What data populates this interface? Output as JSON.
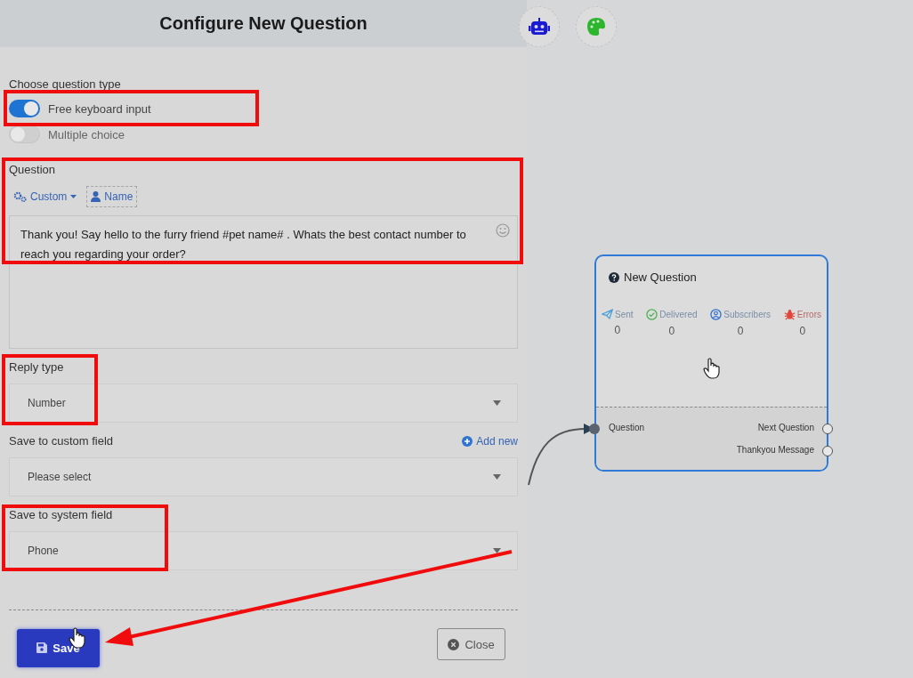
{
  "dialog": {
    "title": "Configure New Question",
    "type_label": "Choose question type",
    "types": [
      {
        "label": "Free keyboard input",
        "on": true
      },
      {
        "label": "Multiple choice",
        "on": false
      }
    ],
    "question": {
      "label": "Question",
      "custom_button": "Custom",
      "name_button": "Name",
      "text": "Thank you! Say hello to the furry friend  #pet name# . Whats the best contact number to reach you regarding your order?"
    },
    "reply_type": {
      "label": "Reply type",
      "value": "Number"
    },
    "custom_field": {
      "label": "Save to custom field",
      "add_link": "Add new",
      "value": "Please select"
    },
    "system_field": {
      "label": "Save to system field",
      "value": "Phone"
    },
    "save_button": "Save",
    "close_button": "Close"
  },
  "node": {
    "title": "New Question",
    "stats": [
      {
        "kind": "sent",
        "label": "Sent",
        "value": "0"
      },
      {
        "kind": "delivered",
        "label": "Delivered",
        "value": "0"
      },
      {
        "kind": "subscribers",
        "label": "Subscribers",
        "value": "0"
      },
      {
        "kind": "errors",
        "label": "Errors",
        "value": "0"
      }
    ],
    "input_port": "Question",
    "output_ports": [
      "Next Question",
      "Thankyou Message"
    ]
  }
}
